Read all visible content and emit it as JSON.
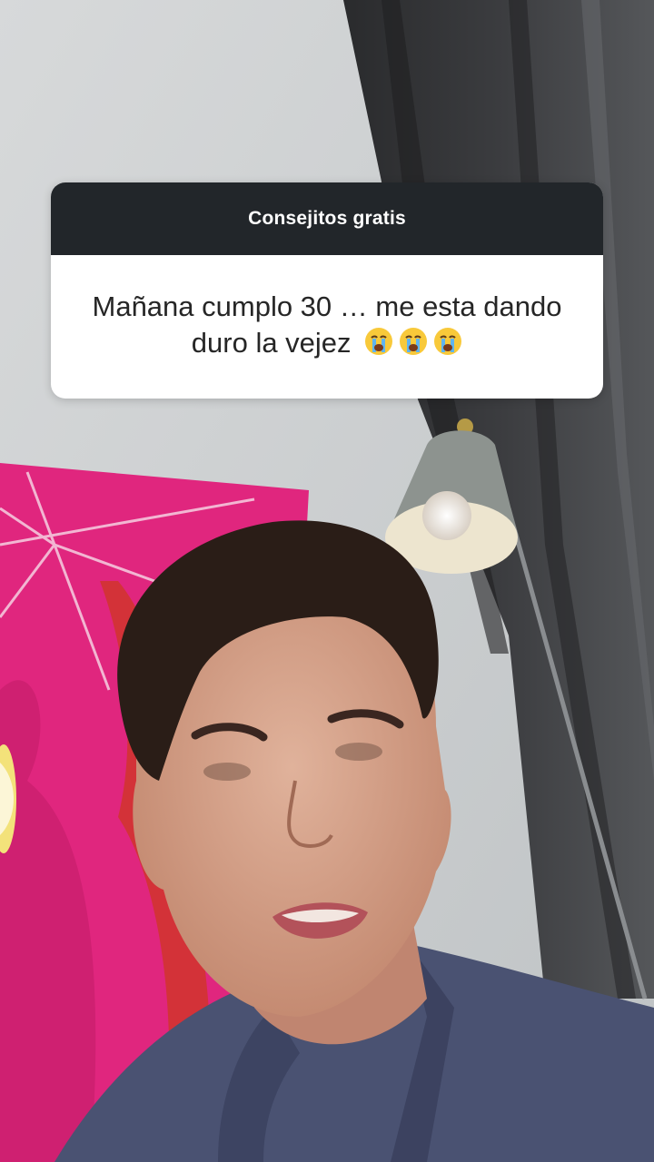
{
  "question_box": {
    "header": "Consejitos gratis",
    "question_line1": "Mañana cumplo 30 … me esta dando",
    "question_line2": "duro la vejez",
    "emoji_icons": [
      "loudly-crying-face-icon",
      "loudly-crying-face-icon",
      "loudly-crying-face-icon"
    ]
  },
  "colors": {
    "header_bg": "#22262a",
    "box_bg": "#ffffff",
    "text": "#262626",
    "poster_pink": "#e0267e"
  }
}
